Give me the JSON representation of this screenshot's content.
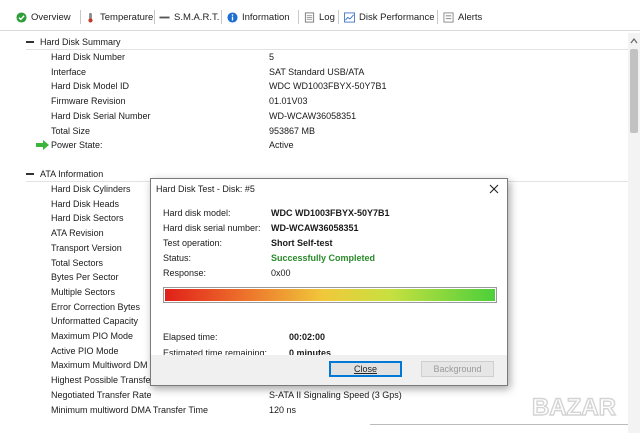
{
  "tabs": [
    {
      "label": "Overview",
      "icon": "check-circle-icon"
    },
    {
      "label": "Temperature",
      "icon": "thermometer-icon"
    },
    {
      "label": "S.M.A.R.T.",
      "icon": "smart-icon"
    },
    {
      "label": "Information",
      "icon": "info-icon"
    },
    {
      "label": "Log",
      "icon": "log-icon"
    },
    {
      "label": "Disk Performance",
      "icon": "chart-icon"
    },
    {
      "label": "Alerts",
      "icon": "alerts-icon"
    }
  ],
  "summary": {
    "title": "Hard Disk Summary",
    "rows": [
      {
        "key": "Hard Disk Number",
        "value": "5"
      },
      {
        "key": "Interface",
        "value": "SAT Standard USB/ATA"
      },
      {
        "key": "Hard Disk Model ID",
        "value": "WDC WD1003FBYX-50Y7B1"
      },
      {
        "key": "Firmware Revision",
        "value": "01.01V03"
      },
      {
        "key": "Hard Disk Serial Number",
        "value": "WD-WCAW36058351"
      },
      {
        "key": "Total Size",
        "value": "953867 MB"
      },
      {
        "key": "Power State:",
        "value": "Active"
      }
    ]
  },
  "ata": {
    "title": "ATA Information",
    "rows": [
      {
        "key": "Hard Disk Cylinders",
        "value": ""
      },
      {
        "key": "Hard Disk Heads",
        "value": ""
      },
      {
        "key": "Hard Disk Sectors",
        "value": ""
      },
      {
        "key": "ATA Revision",
        "value": ""
      },
      {
        "key": "Transport Version",
        "value": ""
      },
      {
        "key": "Total Sectors",
        "value": ""
      },
      {
        "key": "Bytes Per Sector",
        "value": ""
      },
      {
        "key": "Multiple Sectors",
        "value": ""
      },
      {
        "key": "Error Correction Bytes",
        "value": ""
      },
      {
        "key": "Unformatted Capacity",
        "value": ""
      },
      {
        "key": "Maximum PIO Mode",
        "value": ""
      },
      {
        "key": "Active PIO Mode",
        "value": ""
      },
      {
        "key": "Maximum Multiword DM",
        "value": ""
      },
      {
        "key": "Highest Possible Transfer",
        "value": ""
      },
      {
        "key": "Negotiated Transfer Rate",
        "value": "S-ATA II Signaling Speed (3 Gps)"
      },
      {
        "key": "Minimum multiword DMA Transfer Time",
        "value": "120 ns"
      }
    ]
  },
  "dialog": {
    "title": "Hard Disk Test - Disk: #5",
    "fields": [
      {
        "key": "Hard disk model:",
        "value": "WDC WD1003FBYX-50Y7B1",
        "style": "bold"
      },
      {
        "key": "Hard disk serial number:",
        "value": "WD-WCAW36058351",
        "style": "bold"
      },
      {
        "key": "Test operation:",
        "value": "Short Self-test",
        "style": "bold"
      },
      {
        "key": "Status:",
        "value": "Successfully Completed",
        "style": "green"
      },
      {
        "key": "Response:",
        "value": "0x00",
        "style": "normal"
      }
    ],
    "progress_percent": 100,
    "elapsed_label": "Elapsed time:",
    "elapsed_value": "00:02:00",
    "remaining_label": "Estimated time remaining:",
    "remaining_value": "0 minutes",
    "close_label": "Close",
    "background_label": "Background"
  },
  "watermark": "BAZAR",
  "colors": {
    "status_green": "#2a8a2a",
    "accent_blue": "#0078d7",
    "arrow_green": "#3cb43c"
  }
}
